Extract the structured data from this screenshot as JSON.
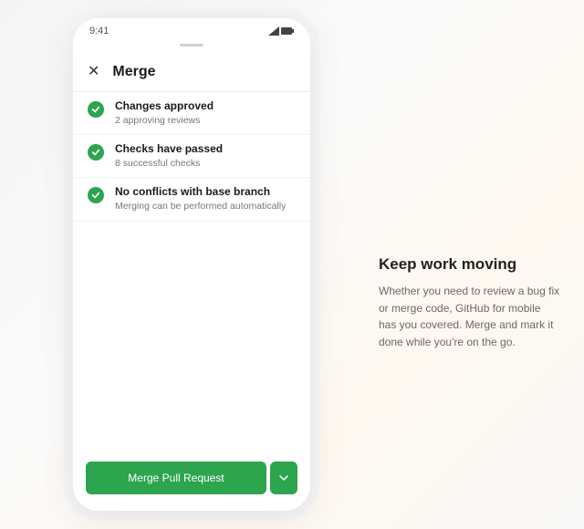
{
  "statusbar": {
    "time": "9:41"
  },
  "header": {
    "title": "Merge"
  },
  "checks": [
    {
      "title": "Changes approved",
      "subtitle": "2 approving reviews"
    },
    {
      "title": "Checks have passed",
      "subtitle": "8 successful checks"
    },
    {
      "title": "No conflicts with base branch",
      "subtitle": "Merging can be performed automatically"
    }
  ],
  "actions": {
    "merge_label": "Merge Pull Request"
  },
  "marketing": {
    "title": "Keep work moving",
    "body": "Whether you need to review a bug fix or merge code, GitHub for mobile has you covered. Merge and mark it done while you're on the go."
  },
  "colors": {
    "success": "#2da44e"
  }
}
